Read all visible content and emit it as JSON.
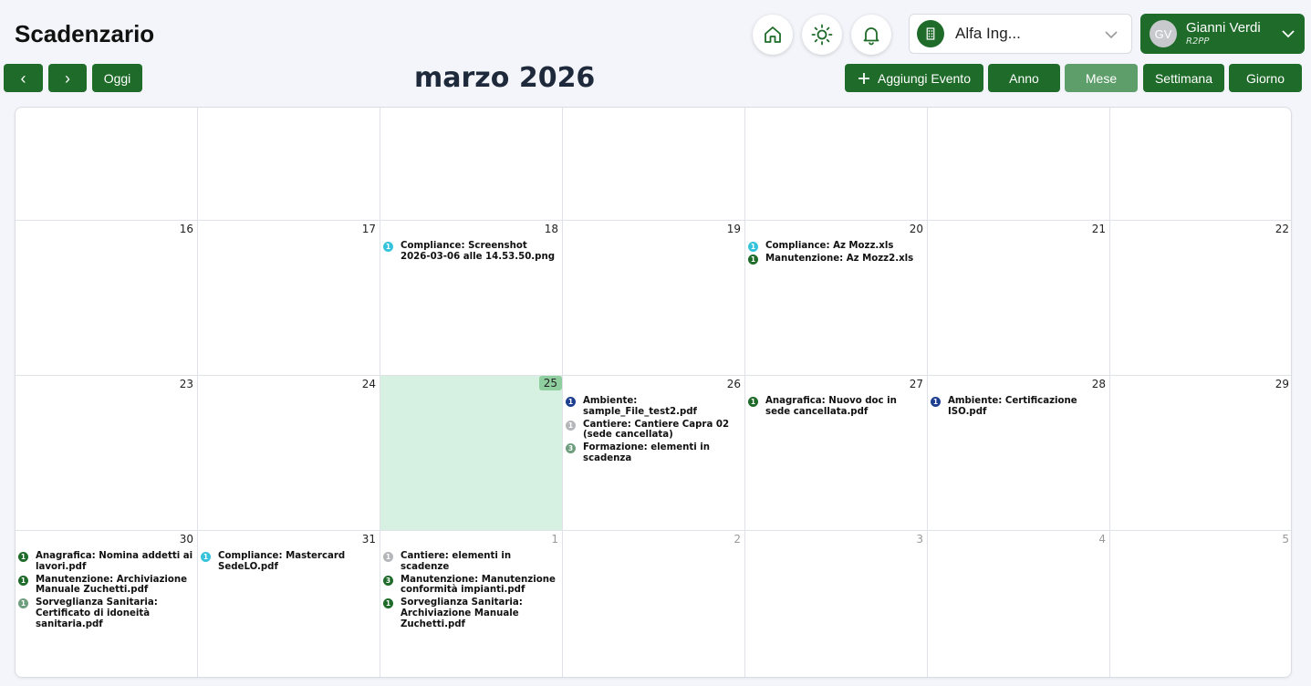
{
  "app": {
    "title": "Scadenzario"
  },
  "header": {
    "company": {
      "name": "Alfa Ing..."
    },
    "user": {
      "initials": "GV",
      "name": "Gianni Verdi",
      "role": "R2PP"
    }
  },
  "toolbar": {
    "prev_label": "‹",
    "next_label": "›",
    "today_label": "Oggi",
    "month_title": "marzo 2026",
    "add_event_label": "Aggiungi Evento",
    "views": [
      "Anno",
      "Mese",
      "Settimana",
      "Giorno"
    ],
    "active_view": "Mese"
  },
  "colors": {
    "primary": "#1f6b2a",
    "active_view": "#5e9e6a",
    "today_bg": "#d6f0e1",
    "badge_cyan": "#35c3dc",
    "badge_navy": "#1e3f8f",
    "badge_green": "#1f6b2a",
    "badge_gray": "#b4b6b9",
    "badge_sage": "#6f9e7e"
  },
  "calendar": {
    "weeks": [
      [
        {
          "day": "",
          "other": false,
          "today": false,
          "events": []
        },
        {
          "day": "",
          "other": false,
          "today": false,
          "events": []
        },
        {
          "day": "",
          "other": false,
          "today": false,
          "events": []
        },
        {
          "day": "",
          "other": false,
          "today": false,
          "events": []
        },
        {
          "day": "",
          "other": false,
          "today": false,
          "events": []
        },
        {
          "day": "",
          "other": false,
          "today": false,
          "events": []
        },
        {
          "day": "",
          "other": false,
          "today": false,
          "events": []
        }
      ],
      [
        {
          "day": "16",
          "other": false,
          "today": false,
          "events": []
        },
        {
          "day": "17",
          "other": false,
          "today": false,
          "events": []
        },
        {
          "day": "18",
          "other": false,
          "today": false,
          "events": [
            {
              "count": "1",
              "color": "#35c3dc",
              "text": "Compliance: Screenshot 2026-03-06 alle 14.53.50.png"
            }
          ]
        },
        {
          "day": "19",
          "other": false,
          "today": false,
          "events": []
        },
        {
          "day": "20",
          "other": false,
          "today": false,
          "events": [
            {
              "count": "1",
              "color": "#35c3dc",
              "text": "Compliance: Az Mozz.xls"
            },
            {
              "count": "1",
              "color": "#1f6b2a",
              "text": "Manutenzione: Az Mozz2.xls"
            }
          ]
        },
        {
          "day": "21",
          "other": false,
          "today": false,
          "events": []
        },
        {
          "day": "22",
          "other": false,
          "today": false,
          "events": []
        }
      ],
      [
        {
          "day": "23",
          "other": false,
          "today": false,
          "events": []
        },
        {
          "day": "24",
          "other": false,
          "today": false,
          "events": []
        },
        {
          "day": "25",
          "other": false,
          "today": true,
          "events": []
        },
        {
          "day": "26",
          "other": false,
          "today": false,
          "events": [
            {
              "count": "1",
              "color": "#1e3f8f",
              "text": "Ambiente: sample_File_test2.pdf"
            },
            {
              "count": "1",
              "color": "#b4b6b9",
              "text": "Cantiere: Cantiere Capra 02 (sede cancellata)"
            },
            {
              "count": "3",
              "color": "#6f9e7e",
              "text": "Formazione: elementi in scadenza"
            }
          ]
        },
        {
          "day": "27",
          "other": false,
          "today": false,
          "events": [
            {
              "count": "1",
              "color": "#1f6b2a",
              "text": "Anagrafica: Nuovo doc in sede cancellata.pdf"
            }
          ]
        },
        {
          "day": "28",
          "other": false,
          "today": false,
          "events": [
            {
              "count": "1",
              "color": "#1e3f8f",
              "text": "Ambiente: Certificazione ISO.pdf"
            }
          ]
        },
        {
          "day": "29",
          "other": false,
          "today": false,
          "events": []
        }
      ],
      [
        {
          "day": "30",
          "other": false,
          "today": false,
          "events": [
            {
              "count": "1",
              "color": "#1f6b2a",
              "text": "Anagrafica: Nomina addetti ai lavori.pdf"
            },
            {
              "count": "1",
              "color": "#1f6b2a",
              "text": "Manutenzione: Archiviazione Manuale Zuchetti.pdf"
            },
            {
              "count": "1",
              "color": "#6f9e7e",
              "text": "Sorveglianza Sanitaria: Certificato di idoneità sanitaria.pdf"
            }
          ]
        },
        {
          "day": "31",
          "other": false,
          "today": false,
          "events": [
            {
              "count": "1",
              "color": "#35c3dc",
              "text": "Compliance: Mastercard SedeLO.pdf"
            }
          ]
        },
        {
          "day": "1",
          "other": true,
          "today": false,
          "events": [
            {
              "count": "1",
              "color": "#b4b6b9",
              "text": "Cantiere: elementi in scadenze"
            },
            {
              "count": "3",
              "color": "#1f6b2a",
              "text": "Manutenzione: Manutenzione conformità impianti.pdf"
            },
            {
              "count": "1",
              "color": "#1f6b2a",
              "text": "Sorveglianza Sanitaria: Archiviazione Manuale Zuchetti.pdf"
            }
          ]
        },
        {
          "day": "2",
          "other": true,
          "today": false,
          "events": []
        },
        {
          "day": "3",
          "other": true,
          "today": false,
          "events": []
        },
        {
          "day": "4",
          "other": true,
          "today": false,
          "events": []
        },
        {
          "day": "5",
          "other": true,
          "today": false,
          "events": []
        }
      ]
    ]
  }
}
